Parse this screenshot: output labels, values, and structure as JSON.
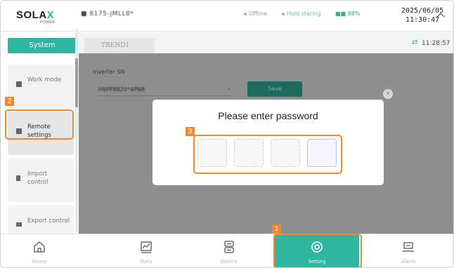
{
  "header": {
    "logo": "SOLA",
    "logo_x": "X",
    "logo_sub": "POWER",
    "serial": "■ 8175-JMLL8*",
    "status_offline": "Offline",
    "status_hold": "Hold staring",
    "status_signal": "■■ 88%",
    "date": "2025/06/05",
    "time": "11:30:47"
  },
  "sidebar": {
    "title": "System",
    "items": [
      {
        "label": "Work mode",
        "icon": "work-mode-icon"
      },
      {
        "label": "Remote settings",
        "icon": "remote-settings-icon"
      },
      {
        "label": "Import control",
        "icon": "import-control-icon"
      },
      {
        "label": "Export control",
        "icon": "export-control-icon"
      }
    ]
  },
  "main": {
    "tab": "TREND1",
    "clock": "11:28:57",
    "inverter_label": "Inverter SN",
    "inverter_value": "H6PP8820*4PN8",
    "save_label": "Save"
  },
  "modal": {
    "title": "Please enter password",
    "digits": [
      "",
      "",
      "",
      ""
    ]
  },
  "annotations": [
    "1",
    "2",
    "3"
  ],
  "bottom_nav": [
    {
      "label": "Home",
      "icon": "home-icon"
    },
    {
      "label": "Data",
      "icon": "data-chart-icon"
    },
    {
      "label": "Device",
      "icon": "device-icon"
    },
    {
      "label": "Setting",
      "icon": "settings-icon"
    },
    {
      "label": "Alarm",
      "icon": "alarm-icon"
    }
  ],
  "colors": {
    "accent": "#2fb5a0",
    "highlight": "#f08a2c",
    "overlay": "#8e8e8e"
  }
}
